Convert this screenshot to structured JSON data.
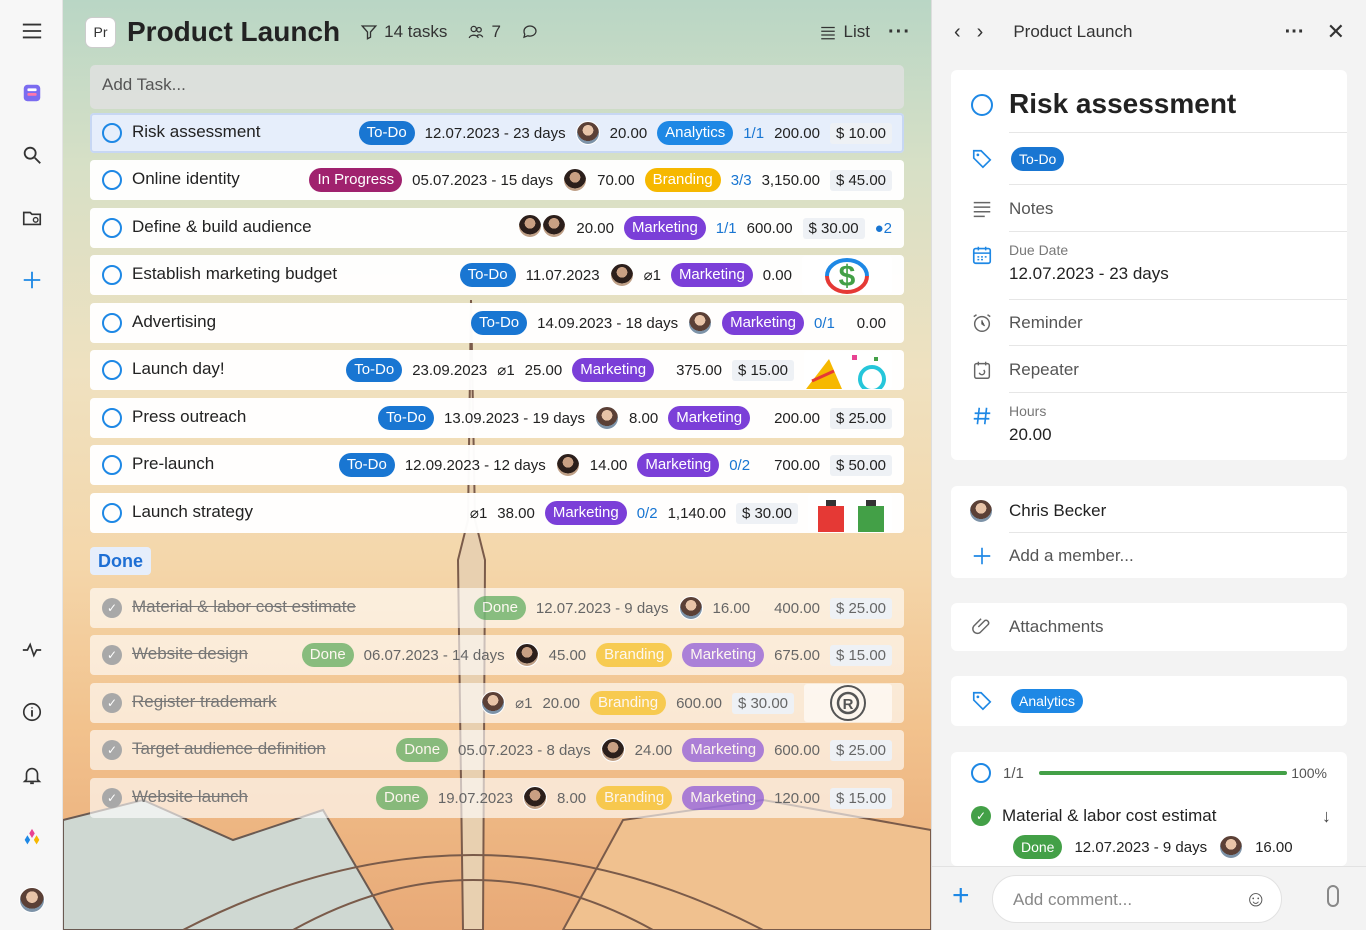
{
  "rail": {
    "icons": [
      "menu-icon",
      "workspace-icon",
      "search-icon",
      "folder-icon",
      "add-icon",
      "activity-icon",
      "info-icon",
      "bell-icon",
      "apps-icon",
      "profile-avatar"
    ]
  },
  "header": {
    "badge": "Pr",
    "title": "Product Launch",
    "tasks": "14 tasks",
    "members": "7",
    "view": "List"
  },
  "add_task_placeholder": "Add Task...",
  "tasks": [
    {
      "name": "Risk assessment",
      "status": "To-Do",
      "date": "12.07.2023 - 23 days",
      "hours": "20.00",
      "tag": "Analytics",
      "checklist": "1/1",
      "cost": "200.00",
      "price": "$ 10.00"
    },
    {
      "name": "Online identity",
      "status": "In Progress",
      "date": "05.07.2023 - 15 days",
      "hours": "70.00",
      "tag": "Branding",
      "checklist": "3/3",
      "cost": "3,150.00",
      "price": "$ 45.00"
    },
    {
      "name": "Define & build audience",
      "hours": "20.00",
      "tag": "Marketing",
      "checklist": "1/1",
      "cost": "600.00",
      "price": "$ 30.00",
      "comments": "2"
    },
    {
      "name": "Establish marketing budget",
      "status": "To-Do",
      "date": "11.07.2023",
      "attach": "1",
      "tag": "Marketing",
      "cost": "0.00"
    },
    {
      "name": "Advertising",
      "status": "To-Do",
      "date": "14.09.2023 - 18 days",
      "tag": "Marketing",
      "checklist": "0/1",
      "cost": "0.00"
    },
    {
      "name": "Launch day!",
      "status": "To-Do",
      "date": "23.09.2023",
      "attach": "1",
      "hours": "25.00",
      "tag": "Marketing",
      "cost": "375.00",
      "price": "$ 15.00"
    },
    {
      "name": "Press outreach",
      "status": "To-Do",
      "date": "13.09.2023 - 19 days",
      "hours": "8.00",
      "tag": "Marketing",
      "cost": "200.00",
      "price": "$ 25.00"
    },
    {
      "name": "Pre-launch",
      "status": "To-Do",
      "date": "12.09.2023 - 12 days",
      "hours": "14.00",
      "tag": "Marketing",
      "checklist": "0/2",
      "cost": "700.00",
      "price": "$ 50.00"
    },
    {
      "name": "Launch strategy",
      "attach": "1",
      "hours": "38.00",
      "tag": "Marketing",
      "checklist": "0/2",
      "cost": "1,140.00",
      "price": "$ 30.00"
    }
  ],
  "done_label": "Done",
  "done_tasks": [
    {
      "name": "Material & labor cost estimate",
      "status": "Done",
      "date": "12.07.2023 - 9 days",
      "hours": "16.00",
      "cost": "400.00",
      "price": "$ 25.00"
    },
    {
      "name": "Website design",
      "status": "Done",
      "date": "06.07.2023 - 14 days",
      "hours": "45.00",
      "tag1": "Branding",
      "tag2": "Marketing",
      "cost": "675.00",
      "price": "$ 15.00"
    },
    {
      "name": "Register trademark",
      "attach": "1",
      "hours": "20.00",
      "tag1": "Branding",
      "cost": "600.00",
      "price": "$ 30.00"
    },
    {
      "name": "Target audience definition",
      "status": "Done",
      "date": "05.07.2023 - 8 days",
      "hours": "24.00",
      "tag2": "Marketing",
      "cost": "600.00",
      "price": "$ 25.00"
    },
    {
      "name": "Website launch",
      "status": "Done",
      "date": "19.07.2023",
      "hours": "8.00",
      "tag1": "Branding",
      "tag2": "Marketing",
      "cost": "120.00",
      "price": "$ 15.00"
    }
  ],
  "panel": {
    "project": "Product Launch",
    "title": "Risk assessment",
    "status": "To-Do",
    "notes_label": "Notes",
    "due_label": "Due Date",
    "due_value": "12.07.2023 - 23 days",
    "reminder_label": "Reminder",
    "repeater_label": "Repeater",
    "hours_label": "Hours",
    "hours_value": "20.00",
    "member": "Chris Becker",
    "add_member": "Add a member...",
    "attachments_label": "Attachments",
    "tag": "Analytics",
    "sub_count": "1/1",
    "sub_pct": "100%",
    "sub_progress": 1.0,
    "sub_name": "Material & labor cost estimat",
    "sub_status": "Done",
    "sub_date": "12.07.2023 - 9 days",
    "sub_hours": "16.00",
    "comment_placeholder": "Add comment..."
  },
  "colors": {
    "accent": "#1e88e5",
    "todo": "#1976d2",
    "in_progress": "#a0226e",
    "done": "#43a047",
    "analytics": "#1e88e5",
    "branding": "#f6b800",
    "marketing": "#7b3fd8"
  }
}
